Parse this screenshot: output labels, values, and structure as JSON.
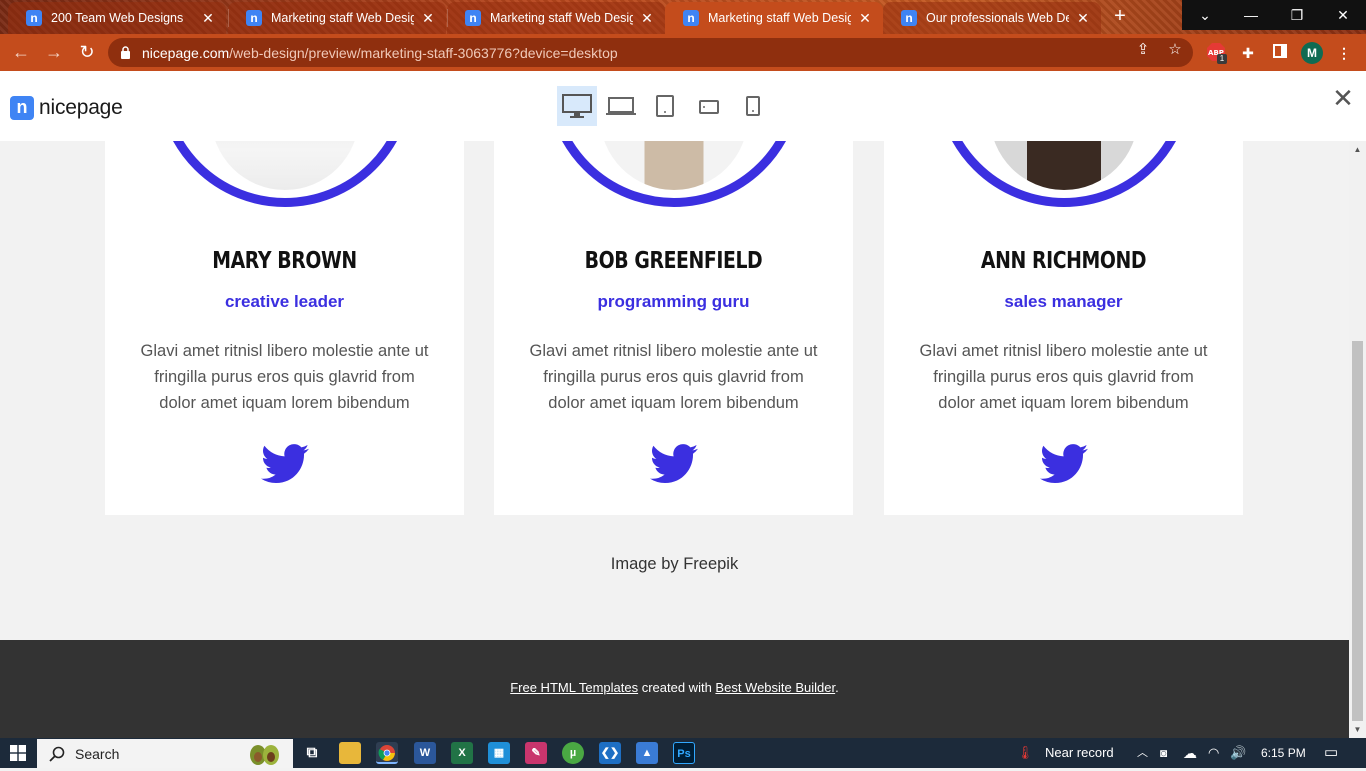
{
  "browser": {
    "tabs": [
      {
        "title": "200 Team Web Designs",
        "active": false
      },
      {
        "title": "Marketing staff Web Design",
        "active": false
      },
      {
        "title": "Marketing staff Web Design",
        "active": false
      },
      {
        "title": "Marketing staff Web Design",
        "active": true
      },
      {
        "title": "Our professionals Web Desig",
        "active": false
      }
    ],
    "favicon_letter": "n",
    "new_tab": "+",
    "url_host": "nicepage.com",
    "url_path": "/web-design/preview/marketing-staff-3063776?device=desktop",
    "profile_initial": "M",
    "extension_badge": "1"
  },
  "preview_header": {
    "logo_mark": "n",
    "logo_text": "nicepage",
    "devices": [
      "desktop",
      "laptop",
      "tablet",
      "tablet-landscape",
      "phone"
    ],
    "selected_device": "desktop",
    "close": "✕"
  },
  "team": [
    {
      "name": "MARY BROWN",
      "role": "creative leader",
      "description": "Glavi amet ritnisl libero molestie ante ut fringilla purus eros quis glavrid from dolor amet iquam lorem bibendum"
    },
    {
      "name": "BOB GREENFIELD",
      "role": "programming guru",
      "description": "Glavi amet ritnisl libero molestie ante ut fringilla purus eros quis glavrid from dolor amet iquam lorem bibendum"
    },
    {
      "name": "ANN RICHMOND",
      "role": "sales manager",
      "description": "Glavi amet ritnisl libero molestie ante ut fringilla purus eros quis glavrid from dolor amet iquam lorem bibendum"
    }
  ],
  "credit": "Image by Freepik",
  "footer": {
    "link1": "Free HTML Templates",
    "middle": " created with ",
    "link2": "Best Website Builder",
    "end": "."
  },
  "taskbar": {
    "search_label": "Search",
    "weather_text": "Near record",
    "time": "6:15 PM"
  },
  "colors": {
    "accent": "#3b2fe0",
    "browser_frame": "#c44c1c",
    "footer_bg": "#333333"
  }
}
